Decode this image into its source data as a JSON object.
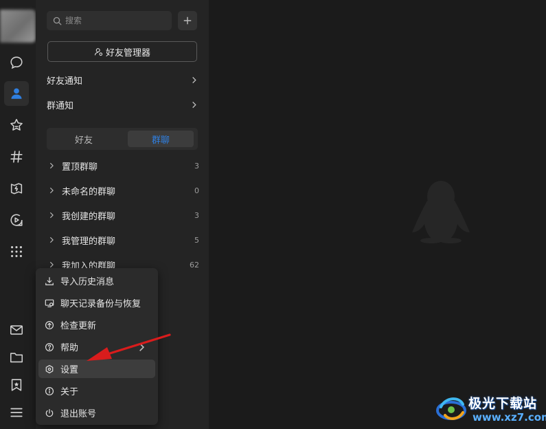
{
  "search": {
    "placeholder": "搜索"
  },
  "panel": {
    "manager_button": "好友管理器",
    "notices": [
      {
        "label": "好友通知"
      },
      {
        "label": "群通知"
      }
    ],
    "tabs": [
      {
        "label": "好友",
        "active": false
      },
      {
        "label": "群聊",
        "active": true
      }
    ],
    "groups": [
      {
        "label": "置顶群聊",
        "count": "3"
      },
      {
        "label": "未命名的群聊",
        "count": "0"
      },
      {
        "label": "我创建的群聊",
        "count": "3"
      },
      {
        "label": "我管理的群聊",
        "count": "5"
      },
      {
        "label": "我加入的群聊",
        "count": "62"
      }
    ]
  },
  "nav": {
    "top_icons": [
      "message-icon",
      "contacts-icon",
      "star-icon",
      "hash-icon",
      "game-icon",
      "video-icon",
      "grid-icon"
    ],
    "bottom_icons": [
      "mail-icon",
      "folder-icon",
      "bookmark-icon",
      "hamburger-menu-icon"
    ],
    "active": "contacts-icon"
  },
  "menu": {
    "items": [
      {
        "label": "导入历史消息",
        "icon": "download-icon"
      },
      {
        "label": "聊天记录备份与恢复",
        "icon": "backup-icon"
      },
      {
        "label": "检查更新",
        "icon": "update-icon"
      },
      {
        "label": "帮助",
        "icon": "help-icon",
        "submenu": true
      },
      {
        "label": "设置",
        "icon": "settings-icon",
        "highlighted": true
      },
      {
        "label": "关于",
        "icon": "info-icon"
      },
      {
        "label": "退出账号",
        "icon": "power-icon"
      }
    ]
  },
  "watermark": {
    "title": "极光下载站",
    "url": "www.xz7.com"
  },
  "colors": {
    "accent": "#2f7fe0",
    "annotation_arrow": "#d91c1c",
    "panel_bg": "#242424",
    "menu_bg": "#2b2b2b"
  }
}
